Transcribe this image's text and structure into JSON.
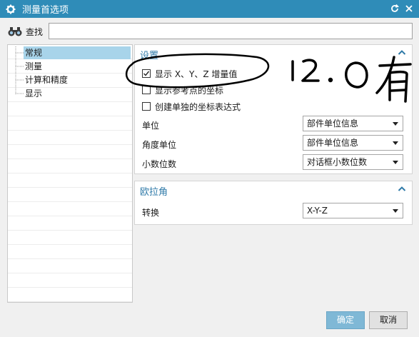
{
  "window": {
    "title": "测量首选项",
    "icons": {
      "app": "gear-icon",
      "reset": "reset-icon",
      "close": "close-icon"
    }
  },
  "search": {
    "label": "查找",
    "value": "",
    "placeholder": "",
    "icon": "binoculars-icon"
  },
  "tree": {
    "items": [
      {
        "label": "常规",
        "selected": true
      },
      {
        "label": "测量",
        "selected": false
      },
      {
        "label": "计算和精度",
        "selected": false
      },
      {
        "label": "显示",
        "selected": false
      }
    ]
  },
  "settings_panel": {
    "title": "设置",
    "checkboxes": [
      {
        "label": "显示 X、Y、Z 增量值",
        "checked": true
      },
      {
        "label": "显示参考点的坐标",
        "checked": false
      },
      {
        "label": "创建单独的坐标表达式",
        "checked": false
      }
    ],
    "fields": [
      {
        "label": "单位",
        "value": "部件单位信息"
      },
      {
        "label": "角度单位",
        "value": "部件单位信息"
      },
      {
        "label": "小数位数",
        "value": "对话框小数位数"
      }
    ]
  },
  "euler_panel": {
    "title": "欧拉角",
    "fields": [
      {
        "label": "转换",
        "value": "X-Y-Z"
      }
    ]
  },
  "buttons": {
    "ok": "确定",
    "cancel": "取消"
  },
  "handwritten_note": "12.0有",
  "colors": {
    "titlebar": "#2f8cb8",
    "accent_text": "#2f7aa8",
    "selection": "#a8d4ea",
    "ok_button": "#7fb8d6"
  }
}
